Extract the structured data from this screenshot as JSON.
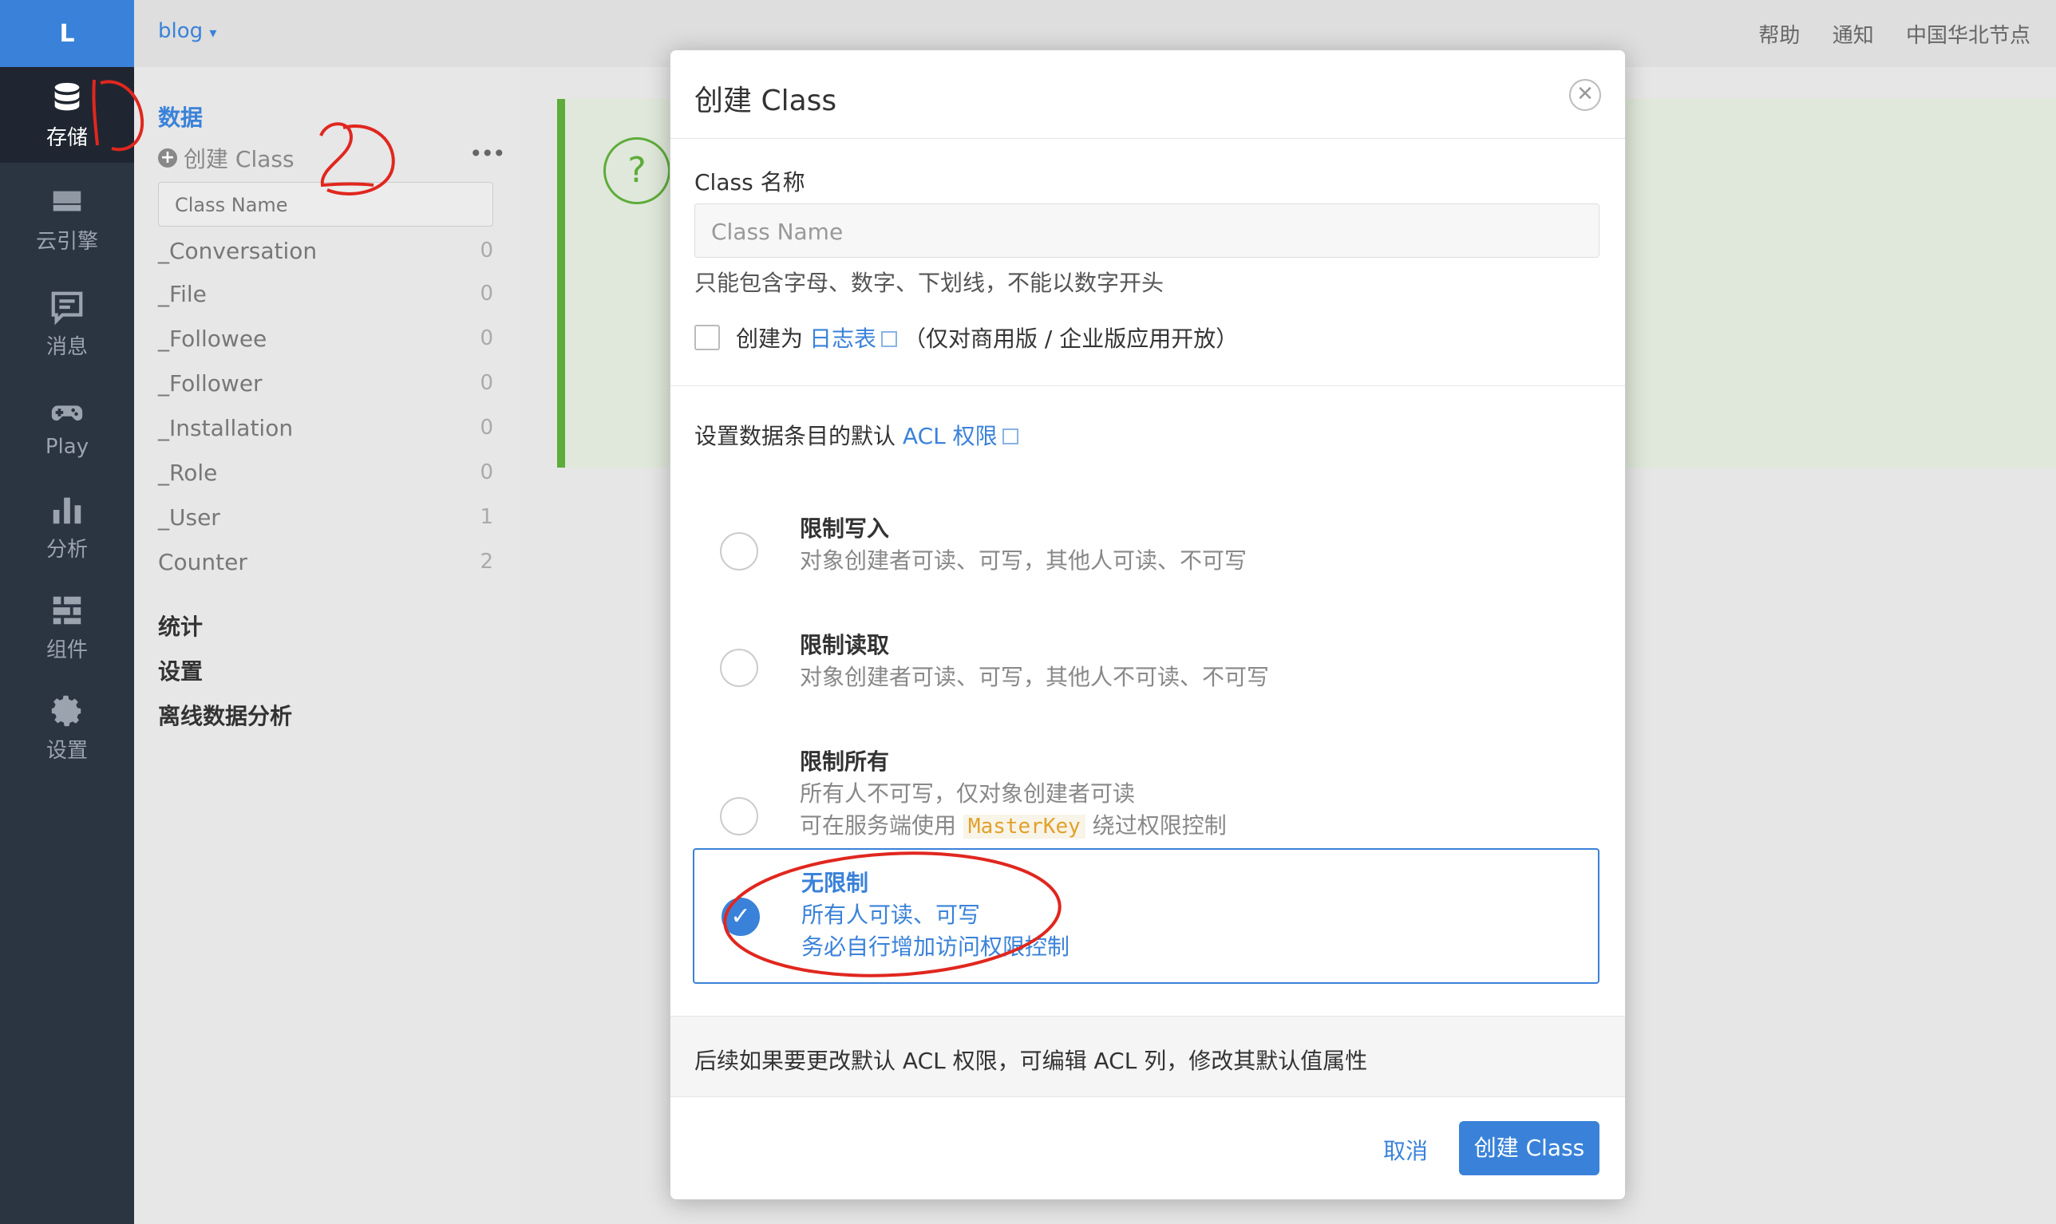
{
  "rail": {
    "logo": "L",
    "items": [
      {
        "label": "存储",
        "icon": "database-icon"
      },
      {
        "label": "云引擎",
        "icon": "server-icon"
      },
      {
        "label": "消息",
        "icon": "message-icon"
      },
      {
        "label": "Play",
        "icon": "gamepad-icon"
      },
      {
        "label": "分析",
        "icon": "bar-chart-icon"
      },
      {
        "label": "组件",
        "icon": "components-icon"
      },
      {
        "label": "设置",
        "icon": "gear-icon"
      }
    ]
  },
  "header": {
    "app_name": "blog",
    "links": [
      "帮助",
      "通知",
      "中国华北节点"
    ]
  },
  "sidebar": {
    "data_title": "数据",
    "create_class": "创建 Class",
    "search_placeholder": "Class Name",
    "classes": [
      {
        "name": "_Conversation",
        "count": "0"
      },
      {
        "name": "_File",
        "count": "0"
      },
      {
        "name": "_Followee",
        "count": "0"
      },
      {
        "name": "_Follower",
        "count": "0"
      },
      {
        "name": "_Installation",
        "count": "0"
      },
      {
        "name": "_Role",
        "count": "0"
      },
      {
        "name": "_User",
        "count": "1"
      },
      {
        "name": "Counter",
        "count": "2"
      }
    ],
    "stats": "统计",
    "settings": "设置",
    "offline": "离线数据分析"
  },
  "modal": {
    "title": "创建 Class",
    "name_label": "Class 名称",
    "name_placeholder": "Class Name",
    "name_hint": "只能包含字母、数字、下划线，不能以数字开头",
    "log_prefix": "创建为",
    "log_link": "日志表",
    "log_suffix": "（仅对商用版 / 企业版应用开放）",
    "acl_prefix": "设置数据条目的默认",
    "acl_link": "ACL 权限",
    "options": [
      {
        "title": "限制写入",
        "line1": "对象创建者可读、可写，其他人可读、不可写",
        "selected": false
      },
      {
        "title": "限制读取",
        "line1": "对象创建者可读、可写，其他人不可读、不可写",
        "selected": false
      },
      {
        "title": "限制所有",
        "line1": "所有人不可写，仅对象创建者可读",
        "line2_prefix": "可在服务端使用",
        "line2_code": "MasterKey",
        "line2_suffix": "绕过权限控制",
        "selected": false
      },
      {
        "title": "无限制",
        "line1": "所有人可读、可写",
        "line2": "务必自行增加访问权限控制",
        "selected": true
      }
    ],
    "footer_note": "后续如果要更改默认 ACL 权限，可编辑 ACL 列，修改其默认值属性",
    "cancel": "取消",
    "create": "创建 Class"
  },
  "colors": {
    "accent": "#3a82d9",
    "rail_bg": "#2b3441",
    "success": "#5eac3a",
    "annotation": "#e0271f"
  }
}
